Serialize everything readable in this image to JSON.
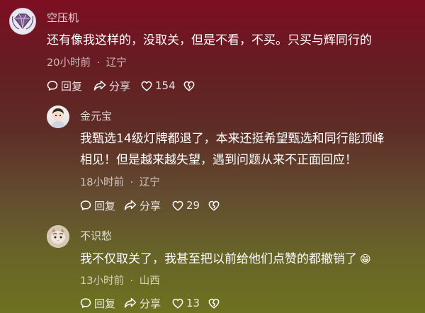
{
  "comments": [
    {
      "username": "空压机",
      "text": [
        "还有像我这样的，没取关，但是不看，不买。只买与辉同行的"
      ],
      "time": "20小时前",
      "location": "辽宁",
      "reply_label": "回复",
      "share_label": "分享",
      "like_count": "154"
    },
    {
      "username": "金元宝",
      "text": [
        "我甄选14级灯牌都退了，本来还挺希望甄选和同行能顶峰",
        "相见！但是越来越失望，遇到问题从来不正面回应！"
      ],
      "time": "18小时前",
      "location": "辽宁",
      "reply_label": "回复",
      "share_label": "分享",
      "like_count": "29"
    },
    {
      "username": "不识愁",
      "text": [
        "我不仅取关了，我甚至把以前给他们点赞的都撤销了"
      ],
      "emoji": "😁",
      "time": "13小时前",
      "location": "山西",
      "reply_label": "回复",
      "share_label": "分享",
      "like_count": "13"
    }
  ],
  "meta_separator": "·",
  "icons": {
    "reply": "speech-bubble-icon",
    "share": "share-arrow-icon",
    "like": "heart-icon",
    "dislike": "broken-heart-icon"
  }
}
